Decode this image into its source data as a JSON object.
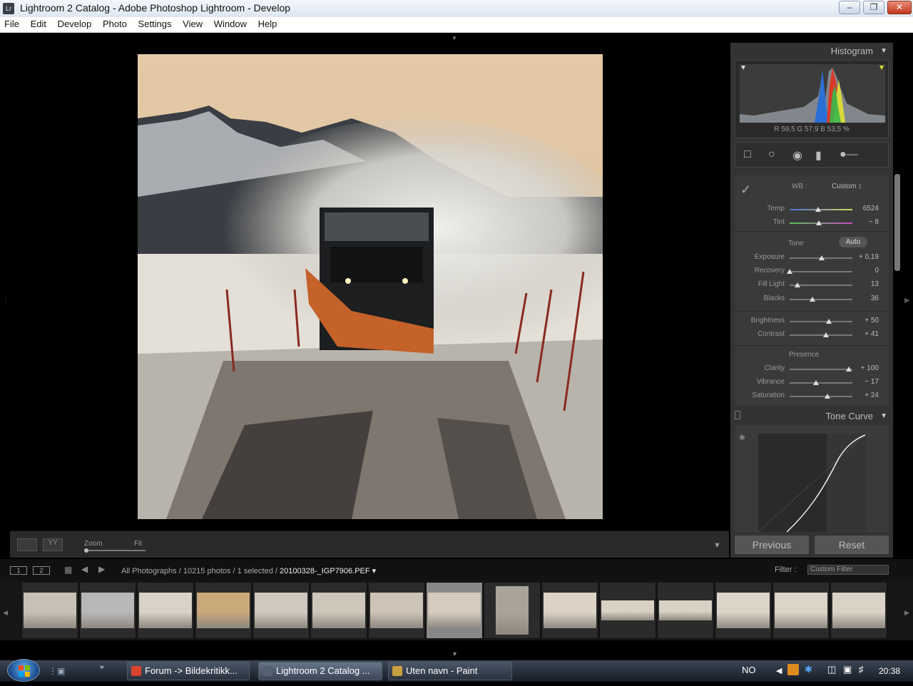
{
  "window": {
    "title": "Lightroom 2 Catalog - Adobe Photoshop Lightroom - Develop",
    "app_icon": "Lr"
  },
  "menu": [
    "File",
    "Edit",
    "Develop",
    "Photo",
    "Settings",
    "View",
    "Window",
    "Help"
  ],
  "toolbar": {
    "zoom_label": "Zoom",
    "zoom_value": "Fit"
  },
  "histogram": {
    "title": "Histogram",
    "readout": "R  59,5   G  57,9   B  53,5  %"
  },
  "basic": {
    "wb_label": "WB :",
    "wb_value": "Custom ↕",
    "tone_label": "Tone",
    "auto_label": "Auto",
    "presence_label": "Presence",
    "sliders": [
      {
        "label": "Temp",
        "value": "6524",
        "pos": 0.45
      },
      {
        "label": "Tint",
        "value": "− 8",
        "pos": 0.47
      },
      {
        "label": "Exposure",
        "value": "+ 0,19",
        "pos": 0.51
      },
      {
        "label": "Recovery",
        "value": "0",
        "pos": 0.0
      },
      {
        "label": "Fill Light",
        "value": "13",
        "pos": 0.13
      },
      {
        "label": "Blacks",
        "value": "36",
        "pos": 0.36
      },
      {
        "label": "Brightness",
        "value": "+ 50",
        "pos": 0.63
      },
      {
        "label": "Contrast",
        "value": "+ 41",
        "pos": 0.58
      },
      {
        "label": "Clarity",
        "value": "+ 100",
        "pos": 0.94
      },
      {
        "label": "Vibrance",
        "value": "− 17",
        "pos": 0.42
      },
      {
        "label": "Saturation",
        "value": "+ 24",
        "pos": 0.6
      }
    ]
  },
  "tone_curve": {
    "title": "Tone Curve"
  },
  "buttons": {
    "previous": "Previous",
    "reset": "Reset"
  },
  "filmstrip_header": {
    "page1": "1",
    "page2": "2",
    "crumb_prefix": "All Photographs / 10215 photos / 1 selected /",
    "filename": "20100328-_IGP7906.PEF ▾",
    "filter_label": "Filter :",
    "filter_value": "Custom Filter"
  },
  "taskbar": {
    "tasks": [
      {
        "label": "Forum -> Bildekritikk...",
        "color": "#d9442c"
      },
      {
        "label": "Lightroom 2 Catalog ...",
        "color": "#556070"
      },
      {
        "label": "Uten navn - Paint",
        "color": "#c8a040"
      }
    ],
    "lang": "NO",
    "clock": "20:38"
  },
  "colors": {
    "panel": "#333333",
    "accent_selected": "#888888"
  }
}
